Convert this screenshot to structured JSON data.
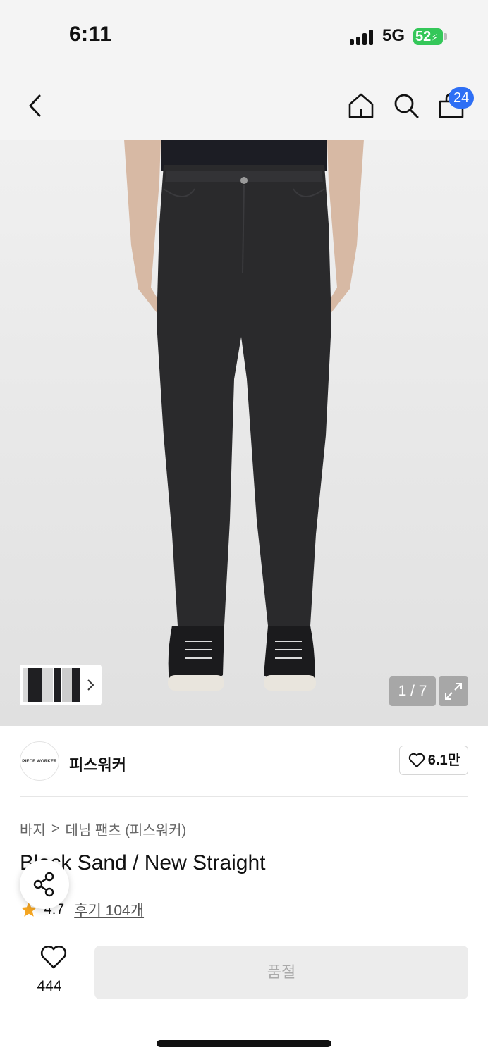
{
  "status_bar": {
    "time": "6:11",
    "network": "5G",
    "battery": "52"
  },
  "nav": {
    "cart_count": "24"
  },
  "gallery": {
    "page_indicator": "1 / 7"
  },
  "brand": {
    "logo_text": "PIECE WORKER",
    "name": "피스워커",
    "likes": "6.1만"
  },
  "breadcrumb": {
    "level1": "바지",
    "separator": ">",
    "level2": "데님 팬츠 (피스워커)"
  },
  "product": {
    "title": "Black Sand / New Straight",
    "rating": "4.7",
    "reviews": "후기 104개"
  },
  "bottom_bar": {
    "wish_count": "444",
    "buy_label": "품절"
  },
  "colors": {
    "accent_blue": "#2e6ff5",
    "star": "#f5a623",
    "battery_green": "#34c759"
  }
}
